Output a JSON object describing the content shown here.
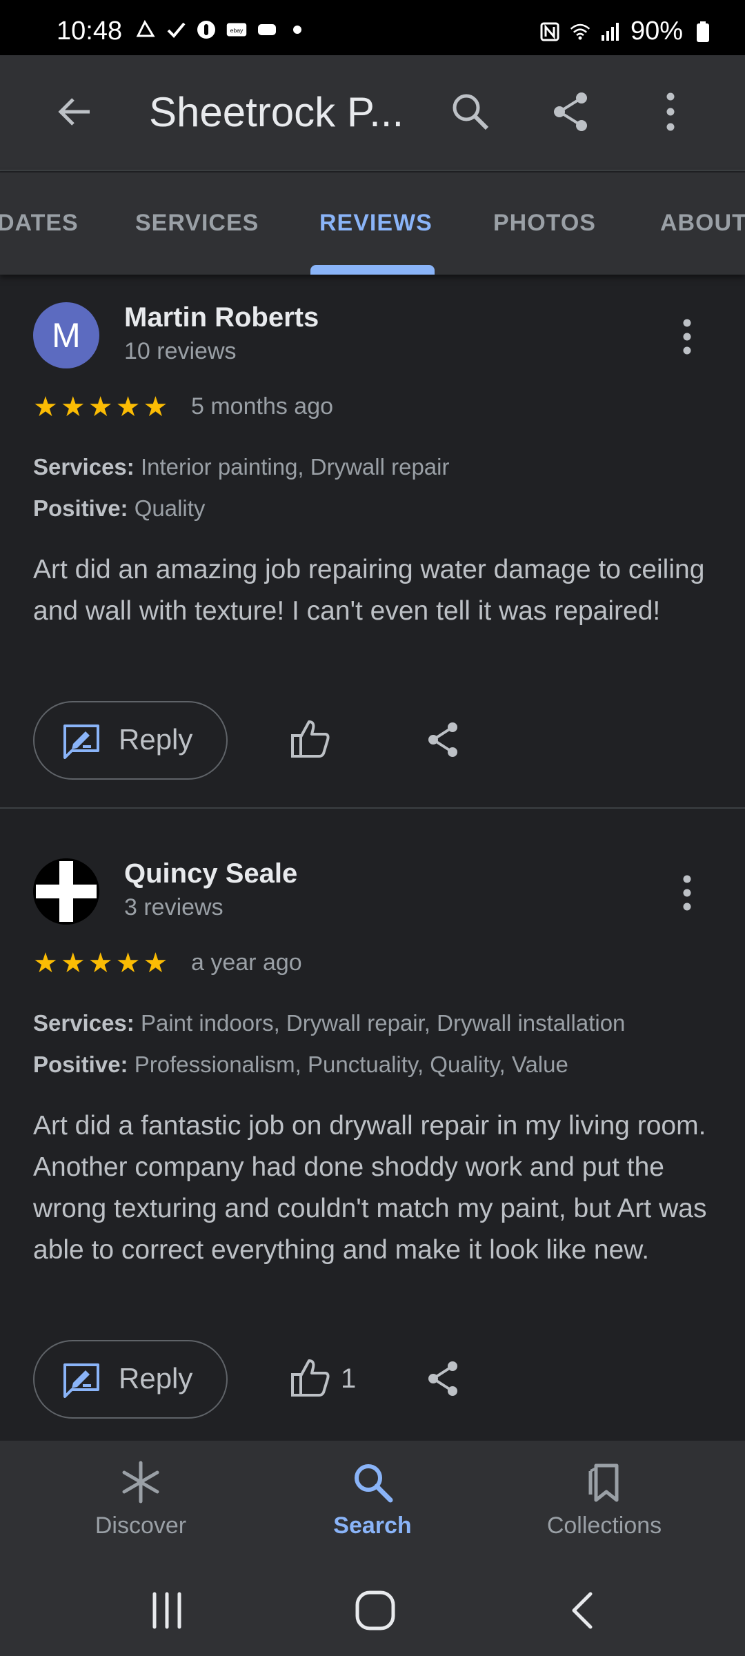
{
  "status_bar": {
    "time": "10:48",
    "battery": "90%",
    "left_icons": [
      "notification-icon",
      "check-icon",
      "app-icon",
      "ebay-icon",
      "message-icon",
      "dot-icon"
    ],
    "right_icons": [
      "nfc-icon",
      "wifi-icon",
      "signal-icon",
      "battery-icon"
    ]
  },
  "app_bar": {
    "title": "Sheetrock P...",
    "actions": [
      "search-icon",
      "share-icon",
      "more-vert-icon"
    ]
  },
  "tabs": [
    {
      "label": "DATES",
      "active": false
    },
    {
      "label": "SERVICES",
      "active": false
    },
    {
      "label": "REVIEWS",
      "active": true
    },
    {
      "label": "PHOTOS",
      "active": false
    },
    {
      "label": "ABOUT",
      "active": false
    }
  ],
  "reviews": [
    {
      "avatar_letter": "M",
      "avatar_color": "#5c6bc0",
      "name": "Martin Roberts",
      "review_count": "10 reviews",
      "rating": 5,
      "date": "5 months ago",
      "services_label": "Services:",
      "services": "Interior painting, Drywall repair",
      "positive_label": "Positive:",
      "positive": "Quality",
      "text": "Art did an amazing job repairing water damage to ceiling and wall with texture! I can't even tell it was repaired!",
      "reply_label": "Reply",
      "likes": ""
    },
    {
      "avatar_letter": "",
      "name": "Quincy Seale",
      "review_count": "3 reviews",
      "rating": 5,
      "date": "a year ago",
      "services_label": "Services:",
      "services": "Paint indoors, Drywall repair, Drywall installation",
      "positive_label": "Positive:",
      "positive": "Professionalism, Punctuality, Quality, Value",
      "text": "Art did a fantastic job on drywall repair in my living room. Another company had done shoddy work and put the wrong texturing and couldn't match my paint, but Art was able to correct everything and make it look like new.",
      "reply_label": "Reply",
      "likes": "1"
    }
  ],
  "bottom_nav": [
    {
      "label": "Discover",
      "icon": "asterisk-icon",
      "active": false
    },
    {
      "label": "Search",
      "icon": "search-icon",
      "active": true
    },
    {
      "label": "Collections",
      "icon": "bookmarks-icon",
      "active": false
    }
  ],
  "colors": {
    "accent": "#8ab4f8",
    "star": "#fbbc04",
    "background": "#202124",
    "surface": "#303134"
  }
}
